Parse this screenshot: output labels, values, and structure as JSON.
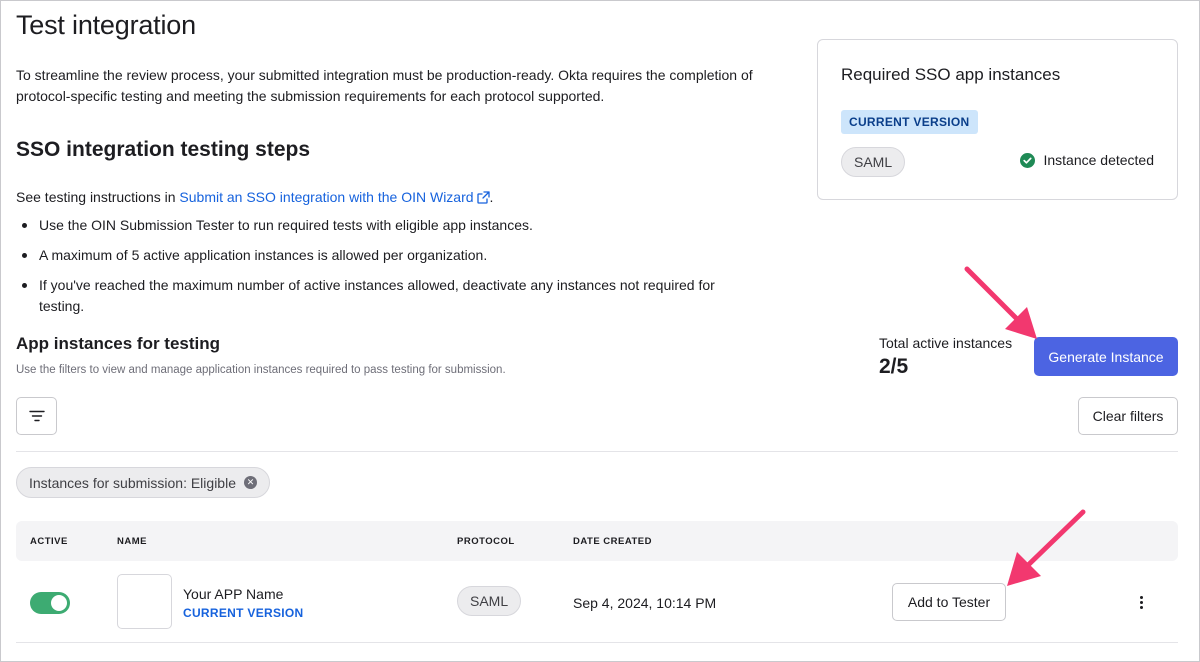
{
  "page": {
    "title": "Test integration",
    "intro": "To streamline the review process, your submitted integration must be production-ready. Okta requires the completion of protocol-specific testing and meeting the submission requirements for each protocol supported."
  },
  "steps": {
    "title": "SSO integration testing steps",
    "instructions_prefix": "See testing instructions in ",
    "instructions_link": "Submit an SSO integration with the OIN Wizard",
    "instructions_suffix": ".",
    "bullets": [
      "Use the OIN Submission Tester to run required tests with eligible app instances.",
      "A maximum of 5 active application instances is allowed per organization.",
      "If you've reached the maximum number of active instances allowed, deactivate any instances not required for testing."
    ]
  },
  "required_card": {
    "title": "Required SSO app instances",
    "badge": "CURRENT VERSION",
    "protocol": "SAML",
    "status": "Instance detected",
    "status_color": "#1f8a56"
  },
  "instances": {
    "title": "App instances for testing",
    "subtitle": "Use the filters to view and manage application instances required to pass testing for submission.",
    "total_label": "Total active instances",
    "total_value": "2/5",
    "generate_button": "Generate Instance",
    "clear_filters_button": "Clear filters",
    "filter_chip": "Instances for submission: Eligible"
  },
  "table": {
    "columns": [
      "ACTIVE",
      "NAME",
      "PROTOCOL",
      "DATE CREATED"
    ],
    "rows": [
      {
        "active": true,
        "name": "Your APP Name",
        "version": "CURRENT VERSION",
        "protocol": "SAML",
        "date_created": "Sep 4, 2024, 10:14 PM",
        "action": "Add to Tester"
      }
    ]
  },
  "colors": {
    "accent": "#4c64e2",
    "link": "#1662dd",
    "toggle_on": "#3dab72",
    "annotation_arrow": "#f2386f"
  },
  "icons": [
    "external-link-icon",
    "check-circle-icon",
    "filter-icon",
    "close-icon",
    "kebab-menu-icon",
    "arrow-annotation-icon"
  ]
}
